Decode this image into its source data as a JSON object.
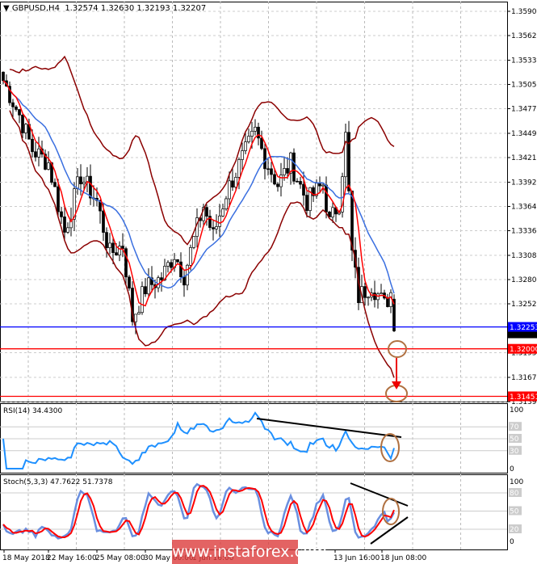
{
  "header": {
    "symbol": "GBPUSD,H4",
    "ohlc": "1.32574 1.32630 1.32193 1.32207"
  },
  "watermark": "www.instaforex.com",
  "chart_data": [
    {
      "type": "candlestick",
      "title": "GBPUSD,H4 1.32574 1.32630 1.32193 1.32207",
      "ylim": [
        1.3139,
        1.3605
      ],
      "yticks": [
        "1.35900",
        "1.35620",
        "1.35335",
        "1.35055",
        "1.34775",
        "1.34490",
        "1.34210",
        "1.33925",
        "1.33645",
        "1.33365",
        "1.33080",
        "1.32800",
        "1.32520",
        "1.31955",
        "1.31670",
        "1.31390"
      ],
      "xticks": [
        "18 May 2018",
        "22 May 16:00",
        "25 May 08:00",
        "30 May 00:00",
        "1 Jun 16:00",
        "13 Jun 16:00",
        "18 Jun 08:00"
      ],
      "last_price": "1.32207",
      "levels": [
        {
          "value": 1.32253,
          "label": "1.32253",
          "color": "#0000ff"
        },
        {
          "value": 1.32,
          "label": "1.32000",
          "color": "#ff0000"
        },
        {
          "value": 1.31451,
          "label": "1.31451",
          "color": "#ff0000"
        }
      ],
      "keypoints": [
        [
          0,
          1.351
        ],
        [
          5,
          1.347
        ],
        [
          9,
          1.343
        ],
        [
          14,
          1.3415
        ],
        [
          19,
          1.3335
        ],
        [
          24,
          1.34
        ],
        [
          29,
          1.337
        ],
        [
          33,
          1.331
        ],
        [
          37,
          1.332
        ],
        [
          40,
          1.3235
        ],
        [
          44,
          1.327
        ],
        [
          49,
          1.3282
        ],
        [
          53,
          1.331
        ],
        [
          56,
          1.3285
        ],
        [
          60,
          1.334
        ],
        [
          62,
          1.3365
        ],
        [
          65,
          1.333
        ],
        [
          69,
          1.338
        ],
        [
          74,
          1.342
        ],
        [
          78,
          1.345
        ],
        [
          81,
          1.342
        ],
        [
          85,
          1.339
        ],
        [
          89,
          1.3415
        ],
        [
          94,
          1.337
        ],
        [
          99,
          1.339
        ],
        [
          101,
          1.3345
        ],
        [
          104,
          1.337
        ],
        [
          106,
          1.3445
        ],
        [
          108,
          1.331
        ],
        [
          110,
          1.326
        ],
        [
          114,
          1.3275
        ],
        [
          118,
          1.325
        ],
        [
          120,
          1.3265
        ],
        [
          121,
          1.3221
        ]
      ],
      "colors": {
        "ma_fast": "#ff0000",
        "ma_slow": "#3a6fe0",
        "bands": "#8b0000"
      }
    },
    {
      "type": "line",
      "title": "RSI(14) 34.4300",
      "name": "RSI(14)",
      "value": "34.4300",
      "levels": [
        "70",
        "50",
        "30"
      ],
      "ylim": [
        0,
        100
      ],
      "ytick_labels": [
        "100",
        "0"
      ],
      "color": "#1e90ff"
    },
    {
      "type": "line",
      "title": "Stoch(5,3,3) 47.7622 51.7378",
      "name": "Stoch(5,3,3)",
      "main": "47.7622",
      "signal": "51.7378",
      "levels": [
        "80",
        "50",
        "20"
      ],
      "ylim": [
        0,
        100
      ],
      "ytick_labels": [
        "100",
        "0"
      ],
      "colors": {
        "main": "#6a8fe0",
        "signal": "#ff0000"
      }
    }
  ]
}
